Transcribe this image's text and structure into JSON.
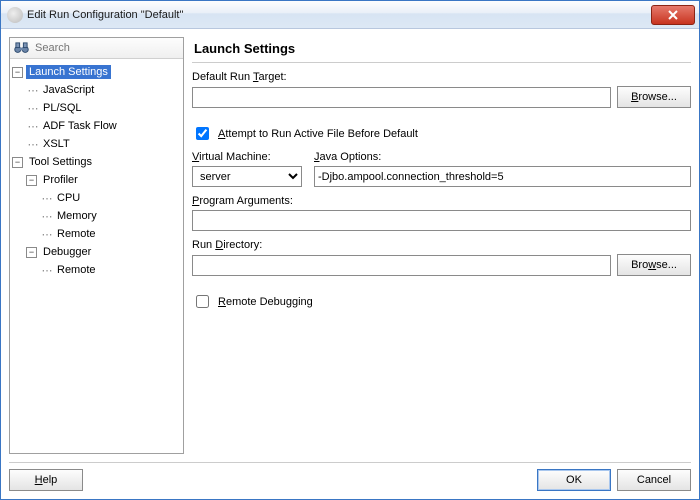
{
  "window": {
    "title": "Edit Run Configuration \"Default\""
  },
  "search": {
    "placeholder": "Search"
  },
  "tree": {
    "launch_settings": "Launch Settings",
    "javascript": "JavaScript",
    "plsql": "PL/SQL",
    "adf_task_flow": "ADF Task Flow",
    "xslt": "XSLT",
    "tool_settings": "Tool Settings",
    "profiler": "Profiler",
    "cpu": "CPU",
    "memory": "Memory",
    "remote_prof": "Remote",
    "debugger": "Debugger",
    "remote_dbg": "Remote"
  },
  "panel": {
    "heading": "Launch Settings",
    "default_run_target_label_pre": "Default Run ",
    "default_run_target_u": "T",
    "default_run_target_label_post": "arget:",
    "default_run_target_value": "",
    "browse1": "Browse...",
    "attempt_u": "A",
    "attempt_rest": "ttempt to Run Active File Before Default",
    "attempt_checked": true,
    "vm_u": "V",
    "vm_rest": "irtual Machine:",
    "vm_value": "server",
    "java_u": "J",
    "java_rest": "ava Options:",
    "java_value": "-Djbo.ampool.connection_threshold=5",
    "prog_u": "P",
    "prog_rest": "rogram Arguments:",
    "prog_value": "",
    "rundir_pre": "Run ",
    "rundir_u": "D",
    "rundir_post": "irectory:",
    "rundir_value": "",
    "browse2": "Browse...",
    "remote_u": "R",
    "remote_rest": "emote Debugging",
    "remote_checked": false
  },
  "buttons": {
    "help": "Help",
    "ok": "OK",
    "cancel": "Cancel"
  }
}
